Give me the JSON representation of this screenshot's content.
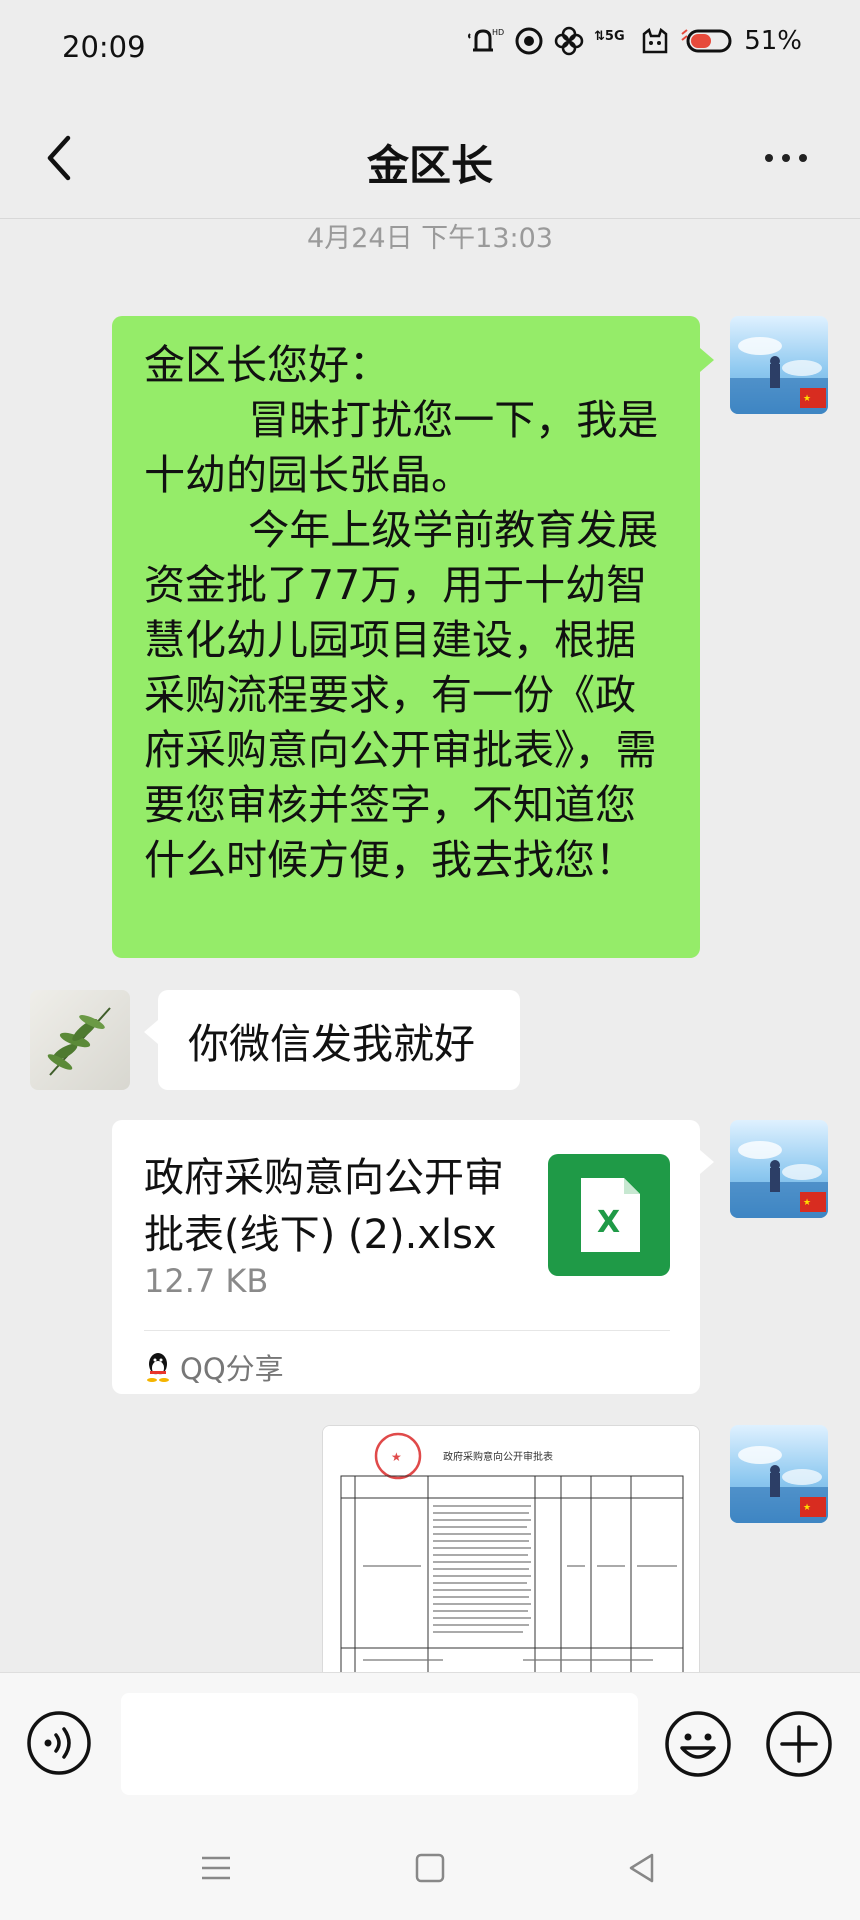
{
  "status_bar": {
    "time": "20:09",
    "network": "5G",
    "battery_percent": "51%",
    "icons": [
      "bell-hd-icon",
      "target-icon",
      "flower-icon",
      "signal-5g-icon",
      "cat-icon",
      "battery-icon"
    ]
  },
  "header": {
    "title": "金区长",
    "back_icon": "chevron-left-icon",
    "more_icon": "more-dots-icon"
  },
  "chat": {
    "timestamp": "4月24日 下午13:03",
    "messages": [
      {
        "sender": "me",
        "type": "text",
        "text": "金区长您好：\n        冒昧打扰您一下，我是十幼的园长张晶。\n        今年上级学前教育发展资金批了77万，用于十幼智慧化幼儿园项目建设，根据采购流程要求，有一份《政府采购意向公开审批表》，需要您审核并签字，不知道您什么时候方便，我去找您！"
      },
      {
        "sender": "other",
        "type": "text",
        "text": "你微信发我就好"
      },
      {
        "sender": "me",
        "type": "file",
        "file_name": "政府采购意向公开审批表(线下) (2).xlsx",
        "file_size": "12.7 KB",
        "source": "QQ分享",
        "file_icon": "excel-icon"
      },
      {
        "sender": "me",
        "type": "image",
        "image_title": "政府采购意向公开审批表"
      }
    ]
  },
  "input_bar": {
    "voice_icon": "voice-icon",
    "input_value": "",
    "emoji_icon": "emoji-icon",
    "plus_icon": "plus-icon"
  },
  "nav_bar": {
    "icons": [
      "menu-icon",
      "home-icon",
      "back-triangle-icon"
    ]
  }
}
